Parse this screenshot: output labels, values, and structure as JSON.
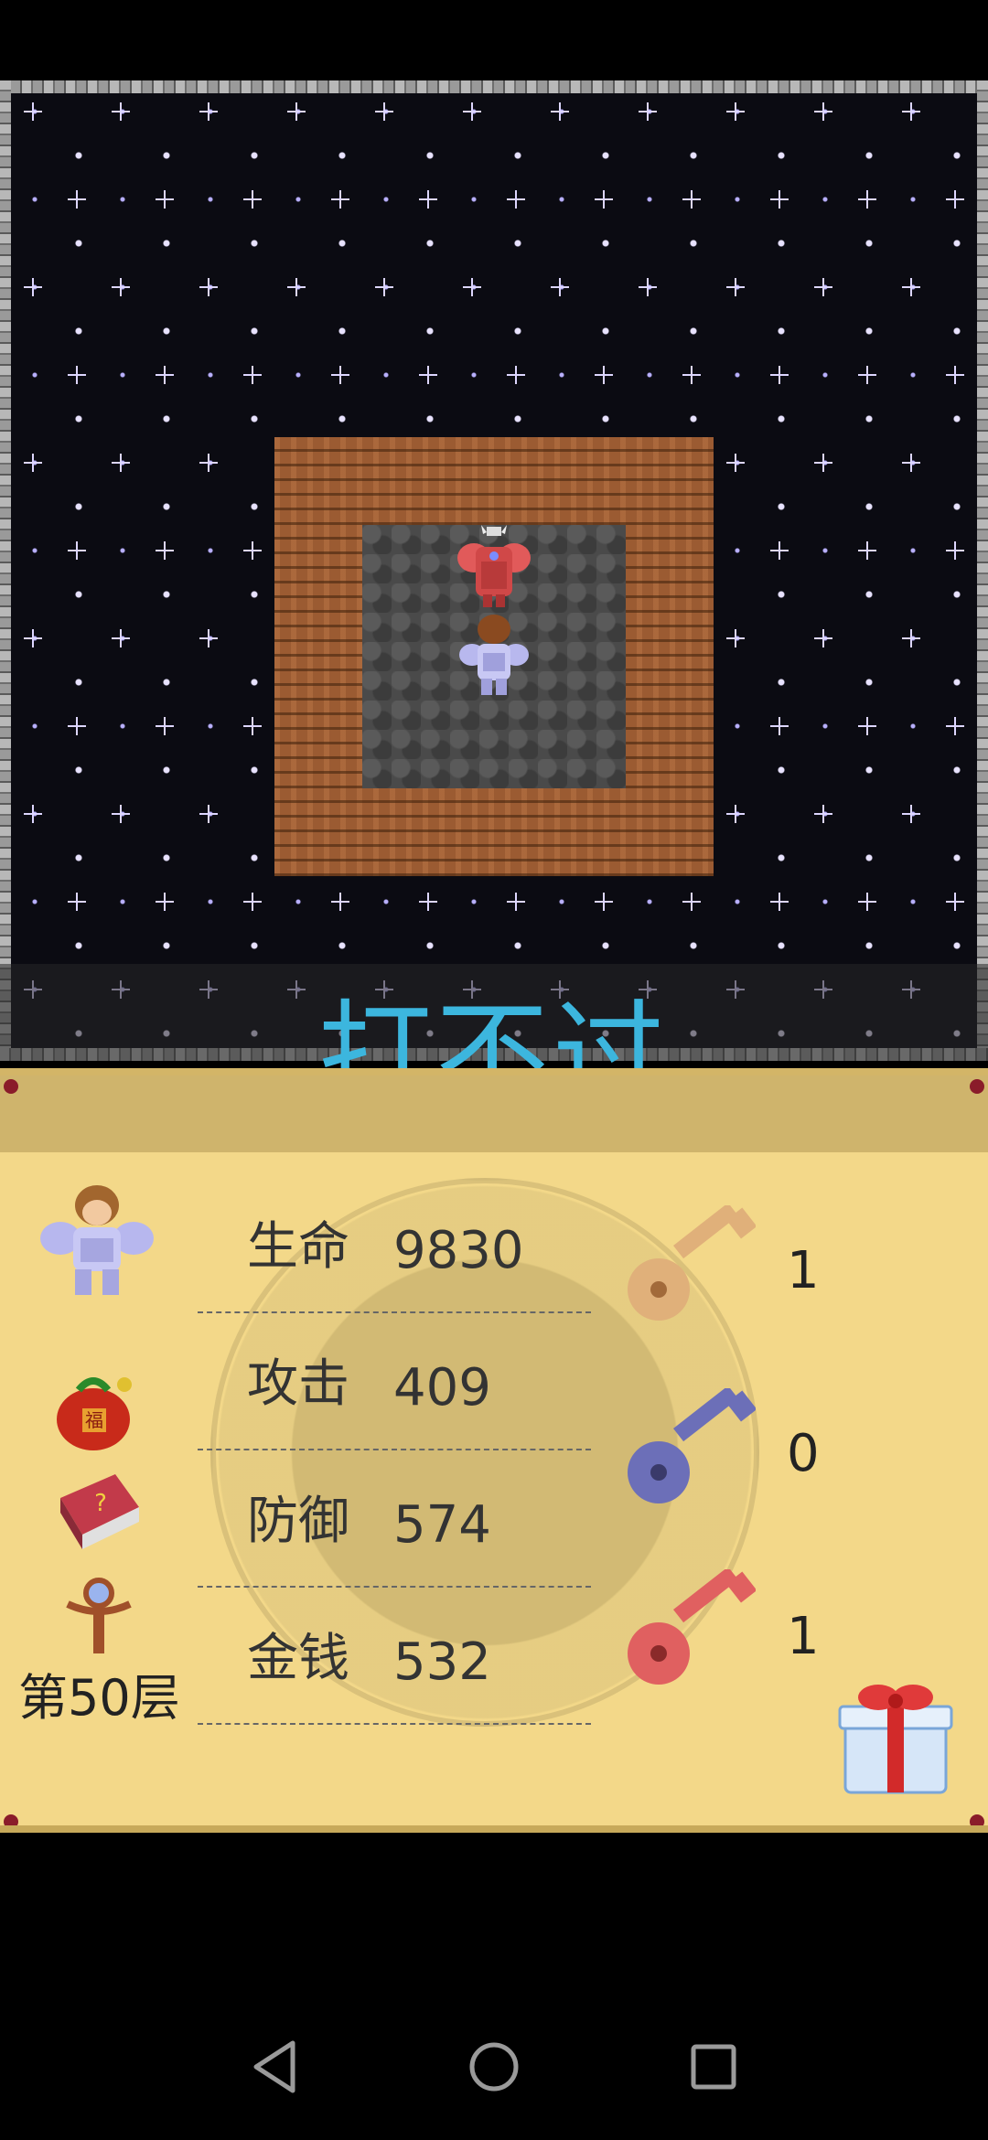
{
  "message": "打不过",
  "stats": {
    "hp_label": "生命",
    "hp_value": "9830",
    "atk_label": "攻击",
    "atk_value": "409",
    "def_label": "防御",
    "def_value": "574",
    "gold_label": "金钱",
    "gold_value": "532"
  },
  "floor_label": "第50层",
  "keys": {
    "yellow": "1",
    "blue": "0",
    "red": "1"
  },
  "colors": {
    "message": "#3cb6de",
    "panel": "#f3d889",
    "yellow_key": "#e0b07a",
    "blue_key": "#6c6fb8",
    "red_key": "#e06060"
  },
  "icons": [
    "hero-portrait-icon",
    "item-bag-icon",
    "monster-book-icon",
    "fly-staff-icon",
    "yellow-key-icon",
    "blue-key-icon",
    "red-key-icon",
    "gift-box-icon",
    "back-icon",
    "home-icon",
    "recents-icon"
  ]
}
